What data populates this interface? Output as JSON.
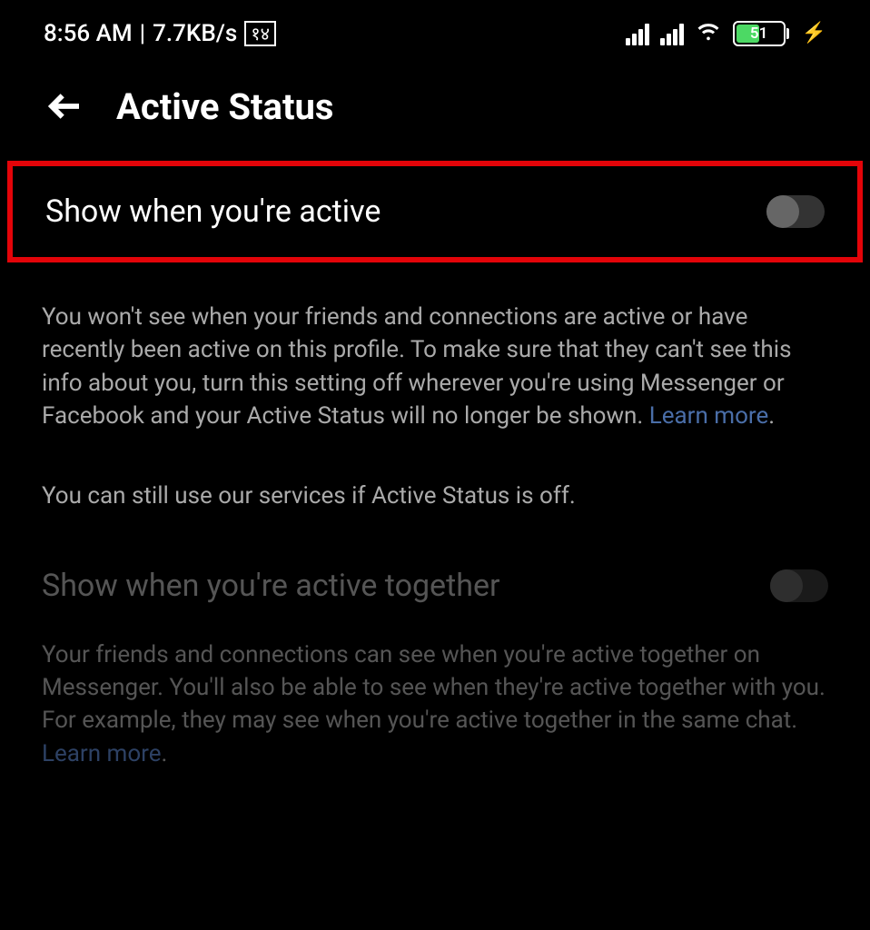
{
  "statusBar": {
    "time": "8:56 AM",
    "separator": " | ",
    "speed": "7.7KB/s",
    "notificationBadge": "१४",
    "batteryPercent": "51"
  },
  "header": {
    "title": "Active Status"
  },
  "setting1": {
    "label": "Show when you're active",
    "description": "You won't see when your friends and connections are active or have recently been active on this profile. To make sure that they can't see this info about you, turn this setting off wherever you're using Messenger or Facebook and your Active Status will no longer be shown. ",
    "learnMore": "Learn more",
    "period": "."
  },
  "note": "You can still use our services if Active Status is off.",
  "setting2": {
    "label": "Show when you're active together",
    "description": "Your friends and connections can see when you're active together on Messenger. You'll also be able to see when they're active together with you. For example, they may see when you're active together in the same chat. ",
    "learnMore": "Learn more",
    "period": "."
  }
}
